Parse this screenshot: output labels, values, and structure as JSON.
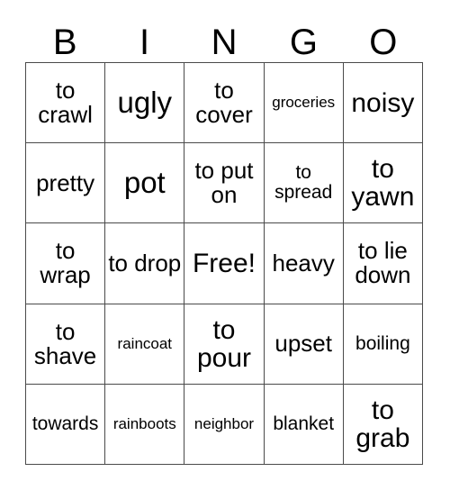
{
  "card": {
    "title_letters": [
      "B",
      "I",
      "N",
      "G",
      "O"
    ],
    "border_color": "#4a4a4a",
    "background_color": "#ffffff",
    "text_color": "#000000",
    "columns": 5,
    "rows": 5,
    "free_space_label": "Free!",
    "cells": [
      [
        {
          "text": "to crawl",
          "size": "md"
        },
        {
          "text": "ugly",
          "size": "xl"
        },
        {
          "text": "to cover",
          "size": "md"
        },
        {
          "text": "groceries",
          "size": "xs"
        },
        {
          "text": "noisy",
          "size": "lg"
        }
      ],
      [
        {
          "text": "pretty",
          "size": "md"
        },
        {
          "text": "pot",
          "size": "xl"
        },
        {
          "text": "to put on",
          "size": "md"
        },
        {
          "text": "to spread",
          "size": "sm"
        },
        {
          "text": "to yawn",
          "size": "lg"
        }
      ],
      [
        {
          "text": "to wrap",
          "size": "md"
        },
        {
          "text": "to drop",
          "size": "md"
        },
        {
          "text": "Free!",
          "size": "lg"
        },
        {
          "text": "heavy",
          "size": "md"
        },
        {
          "text": "to lie down",
          "size": "md"
        }
      ],
      [
        {
          "text": "to shave",
          "size": "md"
        },
        {
          "text": "raincoat",
          "size": "xs"
        },
        {
          "text": "to pour",
          "size": "lg"
        },
        {
          "text": "upset",
          "size": "md"
        },
        {
          "text": "boiling",
          "size": "sm"
        }
      ],
      [
        {
          "text": "towards",
          "size": "sm"
        },
        {
          "text": "rainboots",
          "size": "xs"
        },
        {
          "text": "neighbor",
          "size": "xs"
        },
        {
          "text": "blanket",
          "size": "sm"
        },
        {
          "text": "to grab",
          "size": "lg"
        }
      ]
    ]
  }
}
